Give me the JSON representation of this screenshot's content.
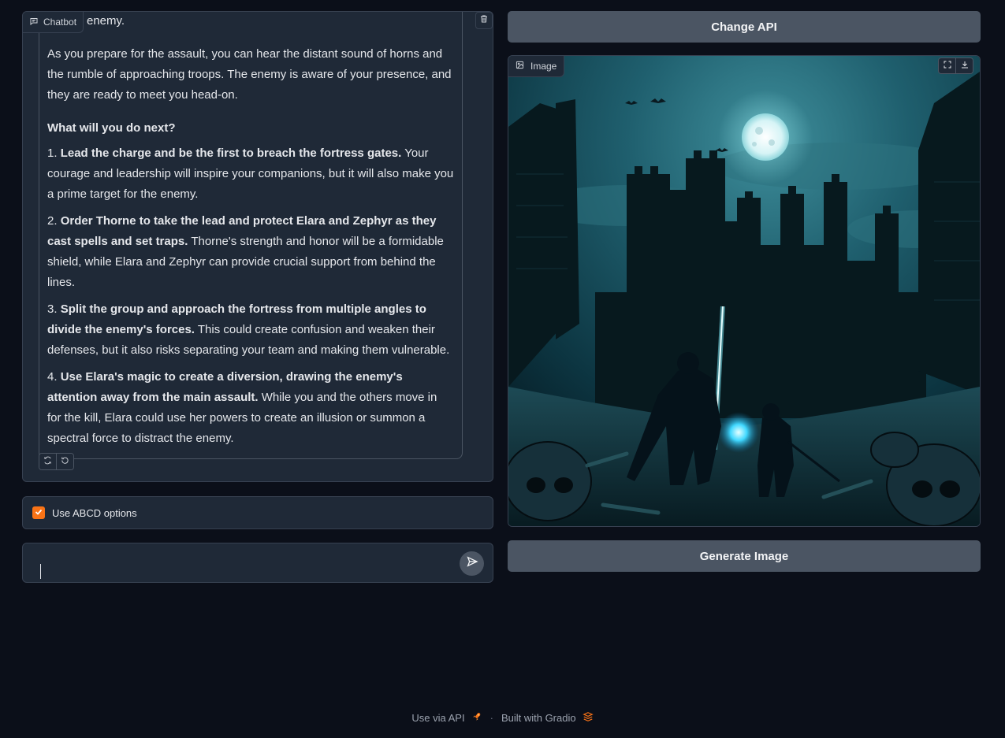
{
  "chatbot": {
    "label": "Chatbot",
    "icon": "chat-icon",
    "message": {
      "intro": "checks his weapons, his eyes scanning the horizon for any sign of the enemy.",
      "para2": "As you prepare for the assault, you can hear the distant sound of horns and the rumble of approaching troops. The enemy is aware of your presence, and they are ready to meet you head-on.",
      "question": "What will you do next?",
      "options": [
        {
          "num": "1.",
          "bold": "Lead the charge and be the first to breach the fortress gates.",
          "text": "Your courage and leadership will inspire your companions, but it will also make you a prime target for the enemy."
        },
        {
          "num": "2.",
          "bold": "Order Thorne to take the lead and protect Elara and Zephyr as they cast spells and set traps.",
          "text": "Thorne's strength and honor will be a formidable shield, while Elara and Zephyr can provide crucial support from behind the lines."
        },
        {
          "num": "3.",
          "bold": "Split the group and approach the fortress from multiple angles to divide the enemy's forces.",
          "text": "This could create confusion and weaken their defenses, but it also risks separating your team and making them vulnerable."
        },
        {
          "num": "4.",
          "bold": "Use Elara's magic to create a diversion, drawing the enemy's attention away from the main assault.",
          "text": "While you and the others move in for the kill, Elara could use her powers to create an illusion or summon a spectral force to distract the enemy."
        }
      ]
    }
  },
  "abcd_checkbox": {
    "label": "Use ABCD options",
    "checked": true,
    "accent": "#f97316"
  },
  "input": {
    "value": "",
    "placeholder": ""
  },
  "buttons": {
    "change_api": "Change API",
    "generate_image": "Generate Image"
  },
  "image": {
    "label": "Image"
  },
  "footer": {
    "use_api": "Use via API",
    "separator": "·",
    "built_with": "Built with Gradio"
  }
}
